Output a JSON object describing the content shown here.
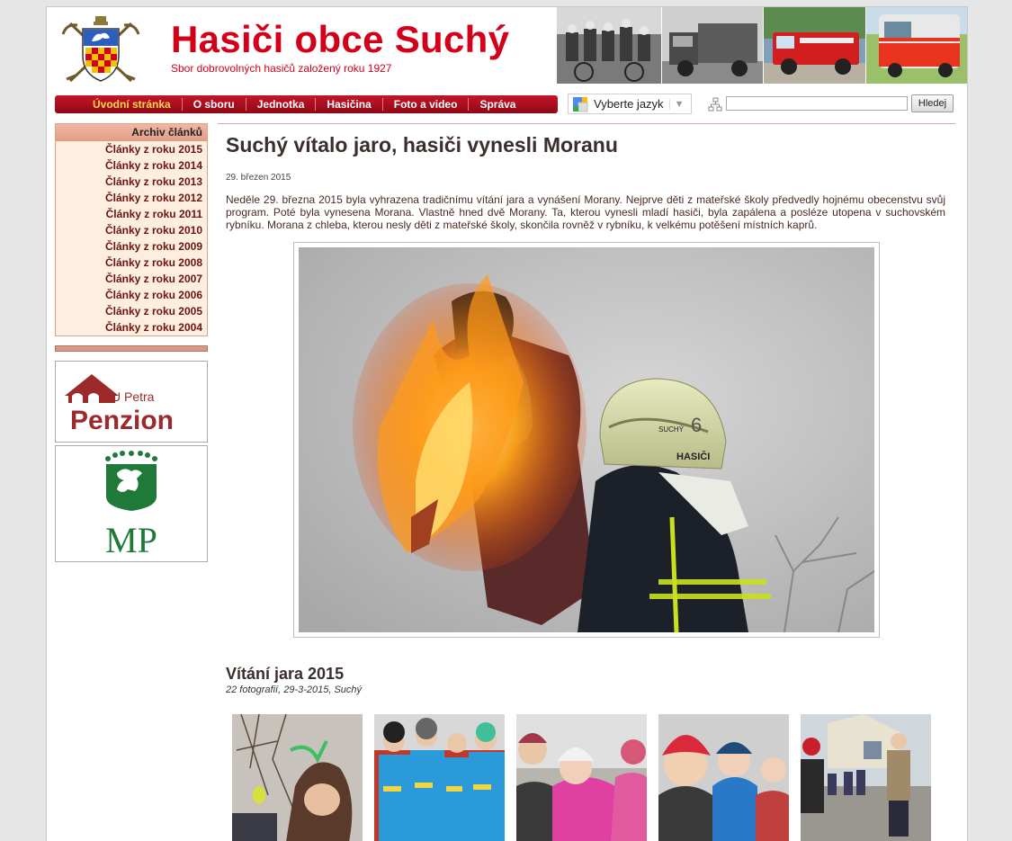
{
  "header": {
    "title": "Hasiči obce Suchý",
    "subtitle": "Sbor dobrovolných hasičů založený roku 1927"
  },
  "nav": {
    "items": [
      {
        "label": "Úvodní stránka",
        "active": true
      },
      {
        "label": "O sboru"
      },
      {
        "label": "Jednotka"
      },
      {
        "label": "Hasičina"
      },
      {
        "label": "Foto a video"
      },
      {
        "label": "Správa"
      }
    ]
  },
  "language": {
    "label": "Vyberte jazyk",
    "arrow": "▼"
  },
  "search": {
    "value": "",
    "button_label": "Hledej"
  },
  "sidebar": {
    "archive_title": "Archiv článků",
    "archive_items": [
      "Články z roku 2015",
      "Články z roku 2014",
      "Články z roku 2013",
      "Články z roku 2012",
      "Články z roku 2011",
      "Články z roku 2010",
      "Články z roku 2009",
      "Články z roku 2008",
      "Články z roku 2007",
      "Články z roku 2006",
      "Články z roku 2005",
      "Články z roku 2004"
    ],
    "banner_penzion": {
      "line1": "U Petra",
      "line2": "Penzion"
    },
    "banner_mp": {
      "text": "MP"
    }
  },
  "article": {
    "title": "Suchý vítalo jaro, hasiči vynesli Moranu",
    "date": "29. březen 2015",
    "body": "Neděle 29. března 2015 byla vyhrazena tradičnímu vítání jara a vynášení Morany. Nejprve děti z mateřské školy předvedly hojnému obecenstvu svůj program. Poté byla vynesena Morana. Vlastně hned dvě Morany. Ta, kterou vynesli mladí hasiči, byla zapálena a posléze utopena v suchovském rybníku. Morana z chleba, kterou nesly děti z mateřské školy, skončila rovněž v rybníku, k velkému potěšení místních kaprů.",
    "helmet_text": "SUCHÝ",
    "helmet_text2": "HASIČI",
    "helmet_number": "6"
  },
  "gallery": {
    "title": "Vítání jara 2015",
    "meta": "22 fotografií, 29-3-2015, Suchý"
  }
}
